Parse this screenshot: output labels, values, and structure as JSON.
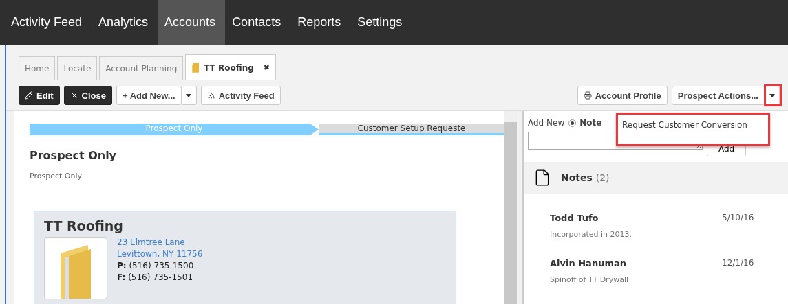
{
  "nav": [
    {
      "label": "Activity Feed",
      "selected": false
    },
    {
      "label": "Analytics",
      "selected": false
    },
    {
      "label": "Accounts",
      "selected": true
    },
    {
      "label": "Contacts",
      "selected": false
    },
    {
      "label": "Reports",
      "selected": false
    },
    {
      "label": "Settings",
      "selected": false
    }
  ],
  "tabs": [
    {
      "label": "Home",
      "selected": false,
      "closable": false
    },
    {
      "label": "Locate",
      "selected": false,
      "closable": false
    },
    {
      "label": "Account Planning",
      "selected": false,
      "closable": false
    },
    {
      "label": "TT Roofing",
      "selected": true,
      "closable": true,
      "close": "✖"
    }
  ],
  "toolbar_left": [
    {
      "label": "Edit",
      "kind": "dark"
    },
    {
      "label": "Close",
      "kind": "dark"
    },
    {
      "label": "+ Add New...",
      "kind": "split"
    },
    {
      "label": "Activity Feed",
      "kind": "light"
    }
  ],
  "toolbar_right": [
    {
      "label": "Account Profile",
      "kind": "light"
    },
    {
      "label": "Prospect Actions...",
      "kind": "split"
    }
  ],
  "menu": {
    "items": [
      "Request Customer Conversion"
    ]
  },
  "stages": [
    {
      "label": "Prospect Only",
      "selected": true
    },
    {
      "label": "Customer Setup Requeste",
      "selected": false
    }
  ],
  "status": {
    "title": "Prospect Only",
    "subtitle": "Prospect Only"
  },
  "account": {
    "name": "TT Roofing",
    "address": [
      "23 Elmtree Lane",
      "Levittown, NY 11756"
    ],
    "phones": [
      {
        "label": "P:",
        "value": "(516) 735-1500"
      },
      {
        "label": "F:",
        "value": "(516) 735-1501"
      }
    ]
  },
  "add_new": {
    "label": "Add New",
    "options": [
      {
        "label": "Note",
        "selected": true
      }
    ],
    "button": "Add"
  },
  "notes": {
    "title": "Notes",
    "count": "(2)",
    "items": [
      {
        "author": "Todd Tufo",
        "date": "5/10/16",
        "text": "Incorporated in 2013."
      },
      {
        "author": "Alvin Hanuman",
        "date": "12/1/16",
        "text": "Spinoff of TT Drywall"
      }
    ]
  }
}
